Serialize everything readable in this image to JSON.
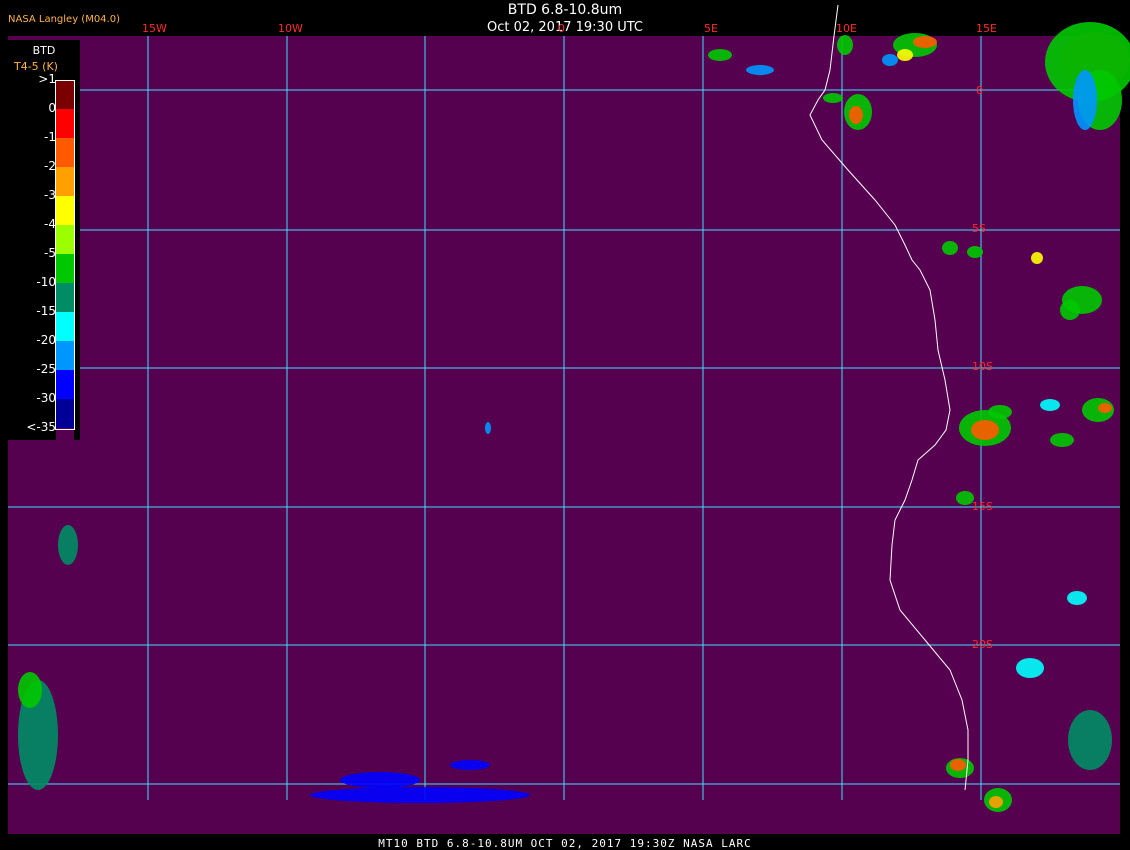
{
  "header": {
    "title": "BTD 6.8-10.8um",
    "subtitle": "Oct 02, 2017 19:30 UTC",
    "producer": "NASA Langley (M04.0)"
  },
  "footer": "MT10   BTD 6.8-10.8UM   OCT 02, 2017 19:30Z   NASA LARC",
  "legend": {
    "title": "BTD",
    "subtitle": "T4-5 (K)",
    "labels": [
      ">1",
      "0",
      "-1",
      "-2",
      "-3",
      "-4",
      "-5",
      "-10",
      "-15",
      "-20",
      "-25",
      "-30",
      "<-35"
    ],
    "colors": [
      "#7a0000",
      "#ff0000",
      "#ff5a00",
      "#ffa000",
      "#ffff00",
      "#9cff00",
      "#00c800",
      "#008c64",
      "#00ffff",
      "#0096ff",
      "#0000ff",
      "#000096",
      "#560050"
    ]
  },
  "map": {
    "background_color": "#560050",
    "grid_color": "#40e0ff",
    "coast_color": "#ffffff",
    "longitude_labels": [
      "15W",
      "10W",
      "0",
      "5E",
      "10E",
      "15E"
    ],
    "latitude_labels": [
      "0",
      "5S",
      "10S",
      "15S",
      "20S"
    ]
  }
}
